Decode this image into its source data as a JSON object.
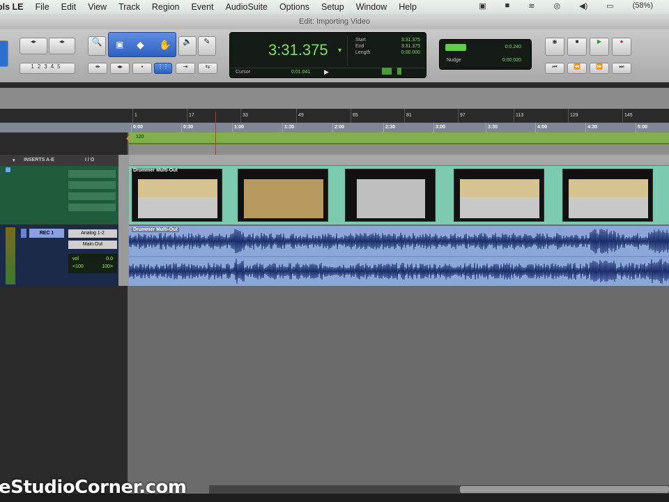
{
  "menubar": {
    "app": "ols LE",
    "items": [
      "File",
      "Edit",
      "View",
      "Track",
      "Region",
      "Event",
      "AudioSuite",
      "Options",
      "Setup",
      "Window",
      "Help"
    ],
    "battery": "(58%)"
  },
  "window": {
    "title": "Edit: Importing Video"
  },
  "counter": {
    "main": "3:31.375",
    "start_label": "Start",
    "end_label": "End",
    "length_label": "Length",
    "start": "3:31.375",
    "end": "3:31.375",
    "length": "0:00.000",
    "cursor_label": "Cursor",
    "cursor": "0:01.041"
  },
  "grid": {
    "grid_value": "0:0.240",
    "nudge_label": "Nudge",
    "nudge_value": "0:00.020"
  },
  "edit_modes": {
    "zoom_presets": [
      "1",
      "2",
      "3",
      "4",
      "5"
    ]
  },
  "ruler": {
    "bars": [
      "1",
      "17",
      "33",
      "49",
      "65",
      "81",
      "97",
      "113",
      "129",
      "145"
    ],
    "minsecs": [
      "0:00",
      "0:30",
      "1:00",
      "1:30",
      "2:00",
      "2:30",
      "3:00",
      "3:30",
      "4:00",
      "4:30",
      "5:00"
    ],
    "tempo": "120"
  },
  "tracks": {
    "inserts_header": "INSERTS A-E",
    "io_header": "I / O",
    "video": {
      "region": "Drummer Multi-Out"
    },
    "audio": {
      "region": "Drummer Multi-Out",
      "name": "REC 1",
      "input": "Analog 1-2",
      "output": "Main Out",
      "vol_label": "vol",
      "vol": "0.0",
      "pan_l": "<100",
      "pan_r": "100>"
    }
  },
  "watermark": "eStudioCorner.com"
}
